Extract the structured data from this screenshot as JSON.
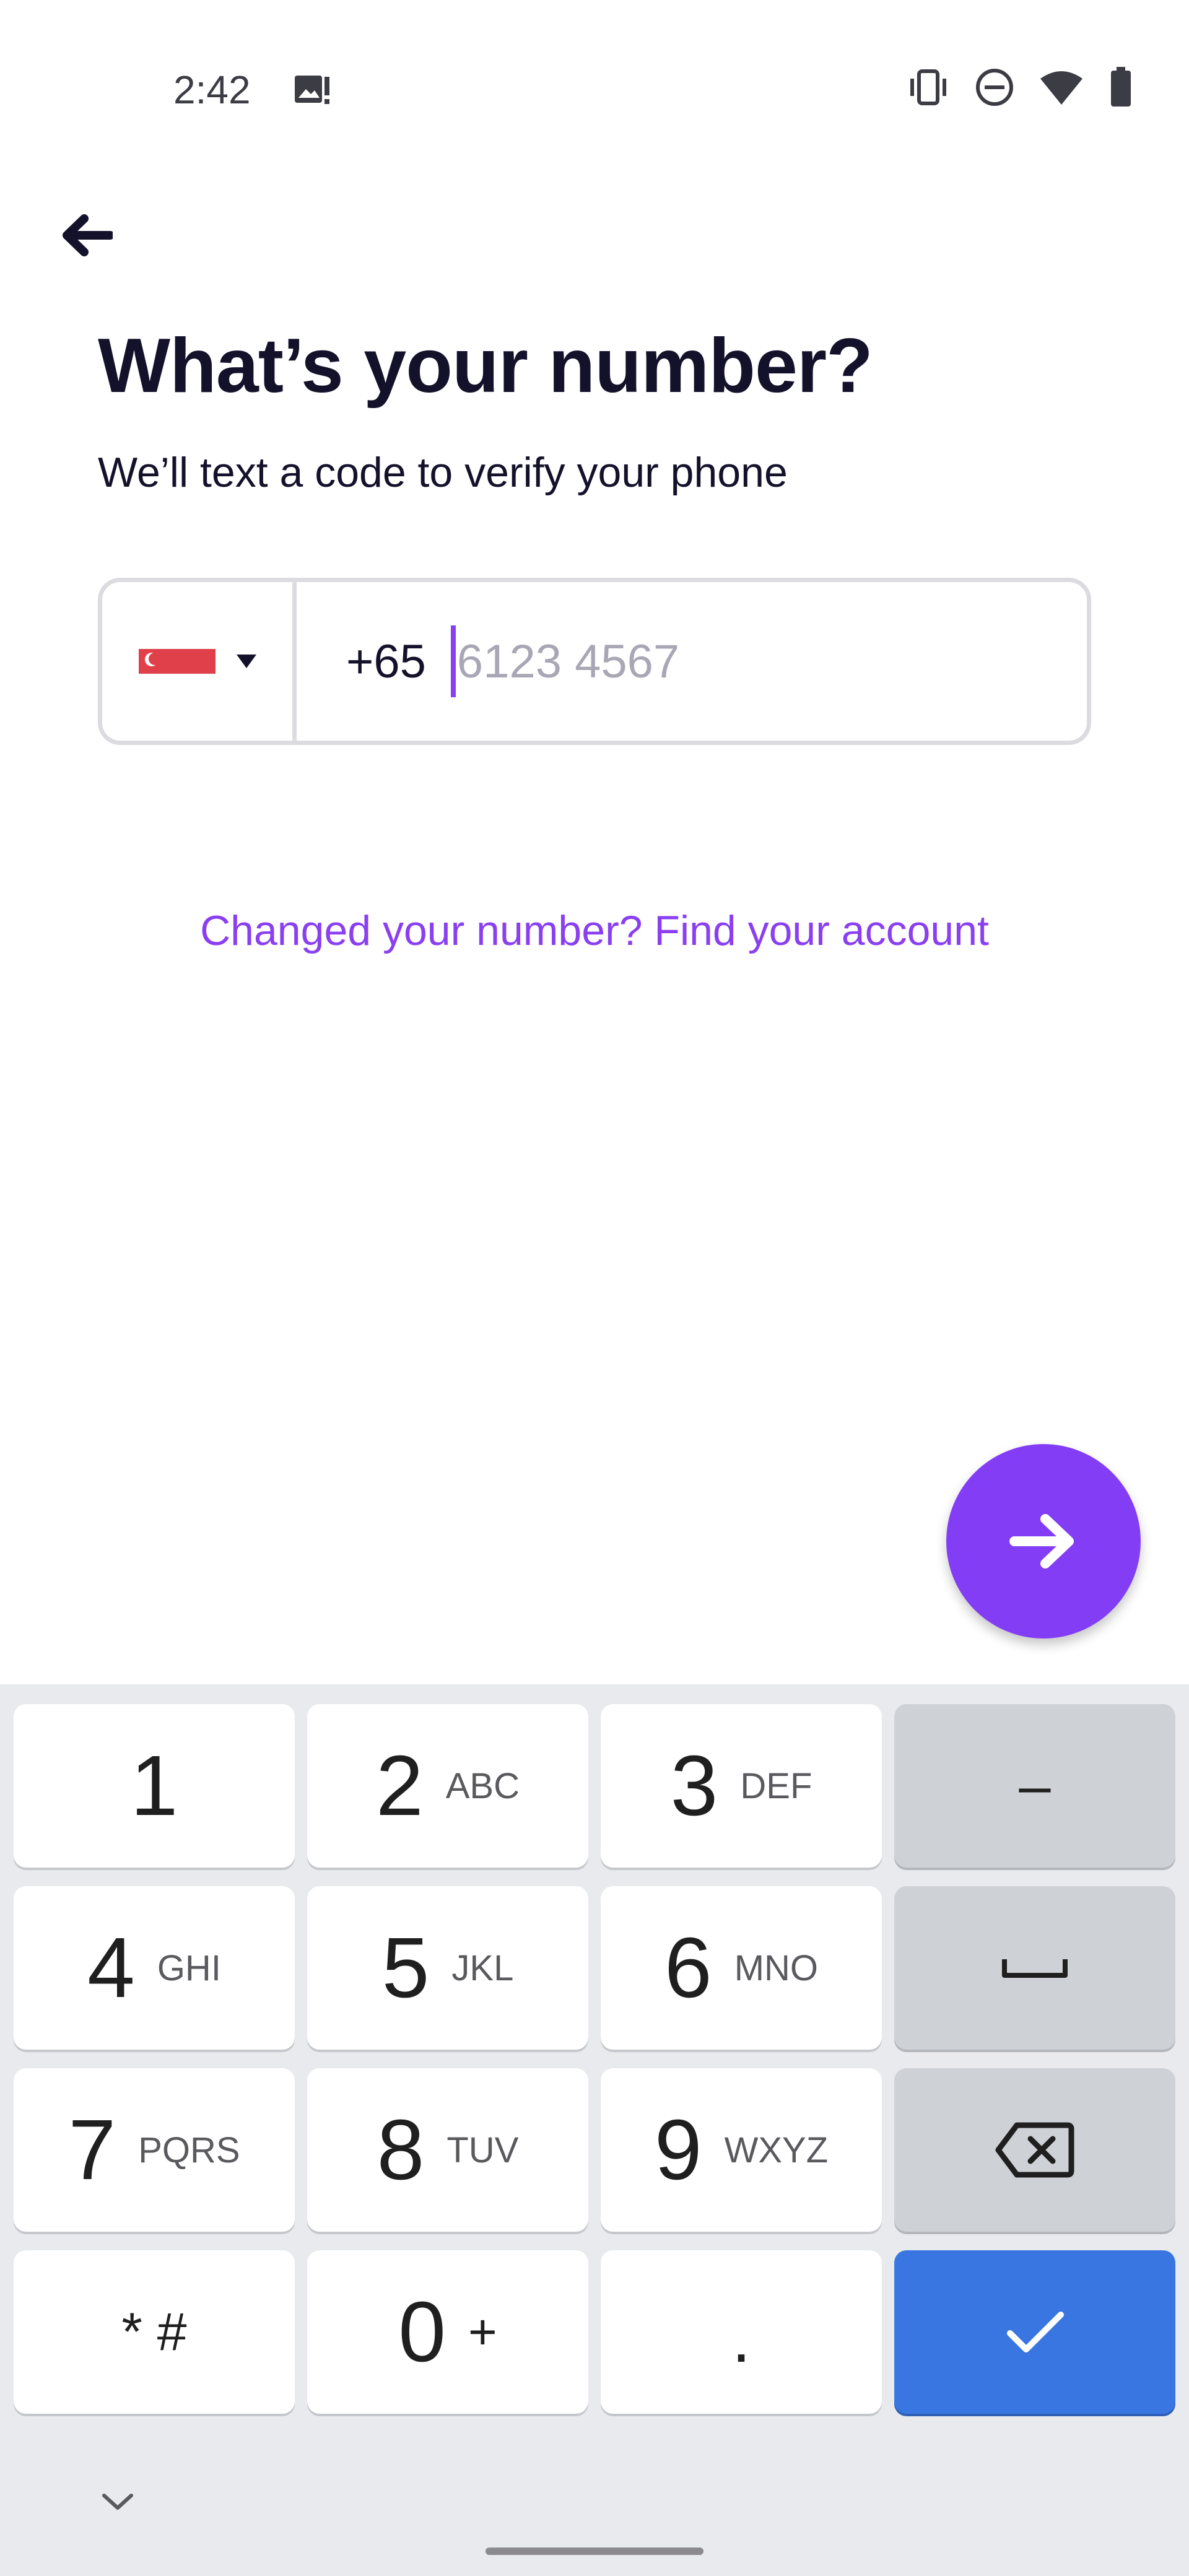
{
  "status_bar": {
    "time": "2:42",
    "icons": [
      "image-alert-icon",
      "vibrate-icon",
      "dnd-icon",
      "wifi-icon",
      "battery-icon"
    ]
  },
  "header": {
    "back_icon": "back-arrow-icon",
    "title": "What’s your number?",
    "subtitle": "We’ll text a code to verify your phone"
  },
  "phone_input": {
    "country_flag": "singapore-flag-icon",
    "dropdown_icon": "caret-down-icon",
    "dial_code": "+65",
    "placeholder": "6123 4567",
    "value": ""
  },
  "link": {
    "find_account": "Changed your number? Find your account"
  },
  "next_button": {
    "icon": "arrow-right-icon",
    "color": "#833ef5"
  },
  "keyboard": {
    "keys": [
      {
        "num": "1",
        "letters": ""
      },
      {
        "num": "2",
        "letters": "ABC"
      },
      {
        "num": "3",
        "letters": "DEF"
      },
      {
        "sym": "–"
      },
      {
        "num": "4",
        "letters": "GHI"
      },
      {
        "num": "5",
        "letters": "JKL"
      },
      {
        "num": "6",
        "letters": "MNO"
      },
      {
        "sym": "space-icon"
      },
      {
        "num": "7",
        "letters": "PQRS"
      },
      {
        "num": "8",
        "letters": "TUV"
      },
      {
        "num": "9",
        "letters": "WXYZ"
      },
      {
        "sym": "backspace-icon"
      },
      {
        "sym": "* #"
      },
      {
        "num": "0",
        "letters": "+"
      },
      {
        "sym": "."
      },
      {
        "sym": "check-icon"
      }
    ],
    "accent": "#3a76e2"
  }
}
